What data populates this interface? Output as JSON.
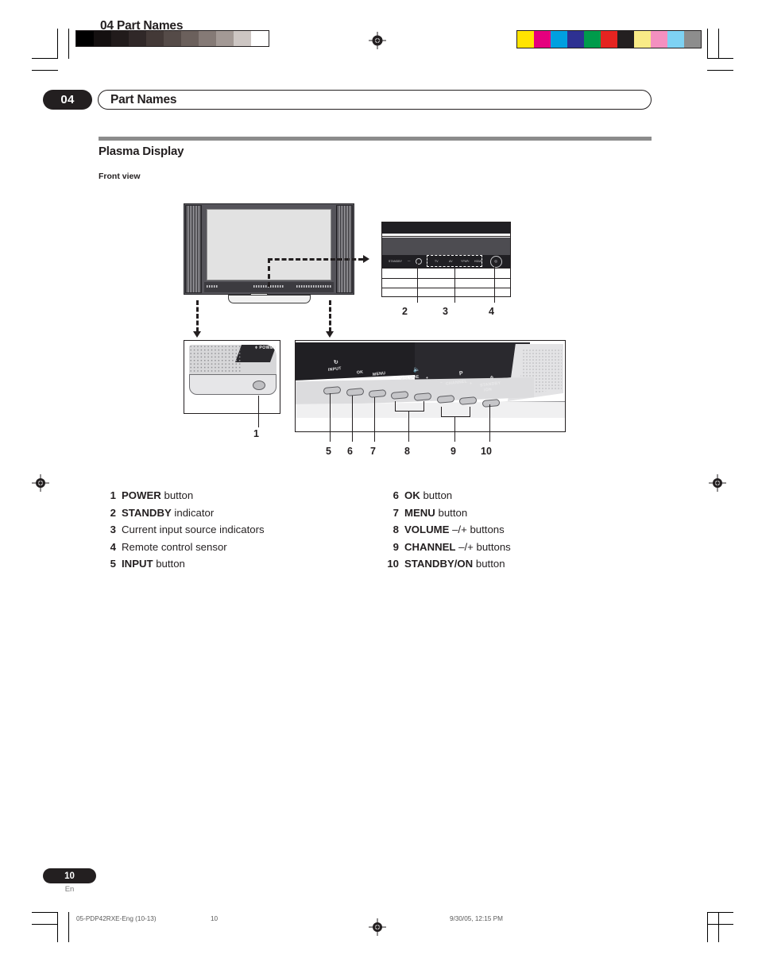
{
  "document": {
    "running_head": "04 Part Names",
    "chapter_number": "04",
    "chapter_title": "Part Names",
    "section_title": "Plasma Display",
    "subsection_title": "Front view",
    "page_number": "10",
    "language_code": "En"
  },
  "figure": {
    "callouts": {
      "c1": "1",
      "c2": "2",
      "c3": "3",
      "c4": "4",
      "c5": "5",
      "c6": "6",
      "c7": "7",
      "c8": "8",
      "c9": "9",
      "c10": "10"
    },
    "power_detail": {
      "label": "POWER"
    },
    "indicator_detail": {
      "standby_label": "STANDBY",
      "inputs": [
        "TV",
        "AV",
        "YPbPr",
        "HDMI"
      ]
    },
    "control_panel": {
      "input_label": "INPUT",
      "ok_label": "OK",
      "menu_label": "MENU",
      "volume_minus": "–",
      "volume_label": "VOLUME",
      "volume_plus": "+",
      "channel_minus": "–",
      "channel_label": "CHANNEL",
      "channel_plus": "+",
      "standby_on_line1": "STANDBY",
      "standby_on_line2": "/ON"
    }
  },
  "legend": {
    "left": [
      {
        "num": "1",
        "bold": "POWER",
        "rest": " button"
      },
      {
        "num": "2",
        "bold": "STANDBY",
        "rest": " indicator"
      },
      {
        "num": "3",
        "bold": "",
        "rest": "Current input source indicators"
      },
      {
        "num": "4",
        "bold": "",
        "rest": "Remote control sensor"
      },
      {
        "num": "5",
        "bold": "INPUT",
        "rest": " button"
      }
    ],
    "right": [
      {
        "num": "6",
        "bold": "OK",
        "rest": " button"
      },
      {
        "num": "7",
        "bold": "MENU",
        "rest": " button"
      },
      {
        "num": "8",
        "bold": "VOLUME",
        "rest": " –/+ buttons"
      },
      {
        "num": "9",
        "bold": "CHANNEL",
        "rest": " –/+ buttons"
      },
      {
        "num": "10",
        "bold": "STANDBY/ON",
        "rest": " button"
      }
    ]
  },
  "print_marks": {
    "slug_file": "05-PDP42RXE-Eng (10-13)",
    "slug_page": "10",
    "slug_timestamp": "9/30/05, 12:15 PM",
    "gray_ramp": [
      "#000000",
      "#141010",
      "#211b1b",
      "#302828",
      "#433937",
      "#554b48",
      "#6b605c",
      "#857a76",
      "#a39995",
      "#cdc6c3",
      "#ffffff"
    ],
    "color_bar": [
      "#ffe400",
      "#e5007e",
      "#00a0e0",
      "#2e3192",
      "#009b4b",
      "#e52421",
      "#231f20",
      "#f9eb87",
      "#f490c0",
      "#7ed2f3",
      "#8d8d8d"
    ]
  }
}
